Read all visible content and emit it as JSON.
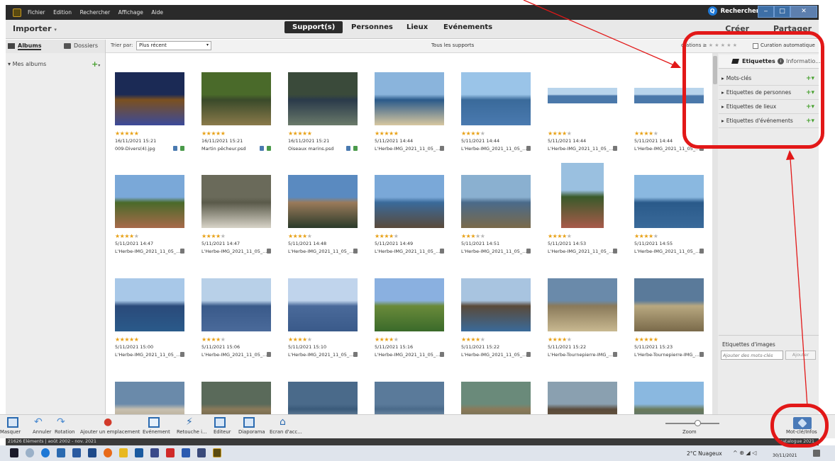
{
  "window": {
    "menu": [
      "Fichier",
      "Edition",
      "Rechercher",
      "Affichage",
      "Aide"
    ],
    "search_label": "Rechercher"
  },
  "modes": {
    "importer": "Importer",
    "tabs": [
      "Support(s)",
      "Personnes",
      "Lieux",
      "Evénements"
    ],
    "create": "Créer",
    "share": "Partager"
  },
  "left": {
    "albums_tab": "Albums",
    "folders_tab": "Dossiers",
    "my_albums": "Mes albums"
  },
  "sort": {
    "label": "Trier par:",
    "value": "Plus récent",
    "center_title": "Tous les supports",
    "ratings_label": "otations ≥",
    "curation": "Curation automatique"
  },
  "photos": [
    {
      "rating": 5,
      "date": "16/11/2021 15:21",
      "name": "009-Divers(4).jpg",
      "colors": [
        "#1b2a55",
        "#3b4a9a",
        "#7b5020"
      ]
    },
    {
      "rating": 5,
      "date": "16/11/2021 15:21",
      "name": "Martin pêcheur.psd",
      "colors": [
        "#4a6a2a",
        "#8a7a4a",
        "#3a4a2a"
      ]
    },
    {
      "rating": 5,
      "date": "16/11/2021 15:21",
      "name": "Oiseaux marins.psd",
      "colors": [
        "#3a4a3a",
        "#6a7a6a",
        "#2a3a4a"
      ]
    },
    {
      "rating": 5,
      "date": "5/11/2021 14:44",
      "name": "L'Herbe-IMG_2021_11_05_...",
      "colors": [
        "#8ab4dc",
        "#d8c8a0",
        "#2a5a8a"
      ]
    },
    {
      "rating": 4,
      "date": "5/11/2021 14:44",
      "name": "L'Herbe-IMG_2021_11_05_...",
      "colors": [
        "#9ac4e8",
        "#4a7ab0",
        "#3a6a9a"
      ]
    },
    {
      "rating": 4,
      "date": "5/11/2021 14:44",
      "name": "L'Herbe-IMG_2021_11_05_...",
      "colors": [
        "#b8d4ec",
        "#4a78aa",
        "#4a78aa"
      ]
    },
    {
      "rating": 4,
      "date": "5/11/2021 14:44",
      "name": "L'Herbe-IMG_2021_11_05_...",
      "colors": [
        "#b8d4ec",
        "#4a78aa",
        "#4a78aa"
      ]
    },
    {
      "rating": 4,
      "date": "5/11/2021 14:47",
      "name": "L'Herbe-IMG_2021_11_05_...",
      "colors": [
        "#7aa8d8",
        "#a86a4a",
        "#4a6a2a"
      ]
    },
    {
      "rating": 4,
      "date": "5/11/2021 14:47",
      "name": "L'Herbe-IMG_2021_11_05_...",
      "colors": [
        "#6a6a5a",
        "#d8d4c8",
        "#5a5a4a"
      ]
    },
    {
      "rating": 4,
      "date": "5/11/2021 14:48",
      "name": "L'Herbe-IMG_2021_11_05_...",
      "colors": [
        "#5a8ac0",
        "#2a3a2a",
        "#9a7a5a"
      ]
    },
    {
      "rating": 4,
      "date": "5/11/2021 14:49",
      "name": "L'Herbe-IMG_2021_11_05_...",
      "colors": [
        "#7aa8d8",
        "#5a4a3a",
        "#3a6a9a"
      ]
    },
    {
      "rating": 3,
      "date": "5/11/2021 14:51",
      "name": "L'Herbe-IMG_2021_11_05_...",
      "colors": [
        "#8ab0d0",
        "#7a6a4a",
        "#4a6a8a"
      ]
    },
    {
      "rating": 4,
      "date": "5/11/2021 14:53",
      "name": "L'Herbe-IMG_2021_11_05_...",
      "colors": [
        "#9ac0e0",
        "#a85a4a",
        "#3a5a2a"
      ]
    },
    {
      "rating": 4,
      "date": "5/11/2021 14:55",
      "name": "L'Herbe-IMG_2021_11_05_...",
      "colors": [
        "#8ab8e0",
        "#3a6a9a",
        "#2a5a8a"
      ]
    },
    {
      "rating": 5,
      "date": "5/11/2021 15:00",
      "name": "L'Herbe-IMG_2021_11_05_...",
      "colors": [
        "#a8c8e8",
        "#2a5a8a",
        "#2a4a7a"
      ]
    },
    {
      "rating": 4,
      "date": "5/11/2021 15:06",
      "name": "L'Herbe-IMG_2021_11_05_...",
      "colors": [
        "#b8d0e8",
        "#4a6a9a",
        "#3a5a8a"
      ]
    },
    {
      "rating": 4,
      "date": "5/11/2021 15:10",
      "name": "L'Herbe-IMG_2021_11_05_...",
      "colors": [
        "#c0d4ec",
        "#3a5a8a",
        "#4a6a9a"
      ]
    },
    {
      "rating": 4,
      "date": "5/11/2021 15:16",
      "name": "L'Herbe-IMG_2021_11_05_...",
      "colors": [
        "#8ab0e0",
        "#3a6a2a",
        "#6a8a3a"
      ]
    },
    {
      "rating": 4,
      "date": "5/11/2021 15:22",
      "name": "L'Herbe-IMG_2021_11_05_...",
      "colors": [
        "#a8c4e0",
        "#3a6a9a",
        "#5a4a3a"
      ]
    },
    {
      "rating": 4,
      "date": "5/11/2021 15:22",
      "name": "L'Herbe-Tournepierre-IMG_...",
      "colors": [
        "#6a8aaa",
        "#c8b890",
        "#8a7a5a"
      ]
    },
    {
      "rating": 5,
      "date": "5/11/2021 15:23",
      "name": "L'Herbe-Tournepierre-IMG_...",
      "colors": [
        "#5a7a9a",
        "#7a6a4a",
        "#b8a880"
      ]
    },
    {
      "rating": 0,
      "date": "",
      "name": "",
      "colors": [
        "#6a8aaa",
        "#9a8a6a",
        "#c8c0b0"
      ]
    },
    {
      "rating": 0,
      "date": "",
      "name": "",
      "colors": [
        "#5a6a5a",
        "#3a3a2a",
        "#8a7a5a"
      ]
    },
    {
      "rating": 0,
      "date": "",
      "name": "",
      "colors": [
        "#4a6a8a",
        "#e0e8f0",
        "#3a5a7a"
      ]
    },
    {
      "rating": 0,
      "date": "",
      "name": "",
      "colors": [
        "#5a7a9a",
        "#e0e8f0",
        "#4a6a8a"
      ]
    },
    {
      "rating": 0,
      "date": "",
      "name": "",
      "colors": [
        "#6a8a7a",
        "#4a5a4a",
        "#8a7a5a"
      ]
    },
    {
      "rating": 0,
      "date": "",
      "name": "",
      "colors": [
        "#8aa0b0",
        "#7a6a4a",
        "#5a4a3a"
      ]
    },
    {
      "rating": 0,
      "date": "",
      "name": "",
      "colors": [
        "#8ab8e0",
        "#4a6a9a",
        "#6a7a5a"
      ]
    }
  ],
  "right": {
    "tags_tab": "Etiquettes",
    "info_tab": "Informatio...",
    "items": [
      "Mots-clés",
      "Etiquettes de personnes",
      "Etiquettes de lieux",
      "Etiquettes d'événements"
    ],
    "image_tags": "Etiquettes d'images",
    "image_tags_placeholder": "Ajouter des mots-clés",
    "add_btn": "Ajouter"
  },
  "bottom": {
    "buttons": [
      "Masquer",
      "Annuler",
      "Rotation",
      "Ajouter un emplacement",
      "Evénement",
      "Retouche i...",
      "Editeur",
      "Diaporama",
      "Ecran d'acc..."
    ],
    "zoom": "Zoom",
    "keyword_info": "Mot-clé/Infos"
  },
  "status": {
    "text": "21626 Eléments | août 2002 - nov. 2021",
    "catalog": "catalogue 2021"
  },
  "taskbar": {
    "weather": "2°C Nuageux",
    "time": "30/11/2021"
  },
  "colors": {
    "annotation": "#e21818",
    "accent_star": "#e8a117"
  }
}
